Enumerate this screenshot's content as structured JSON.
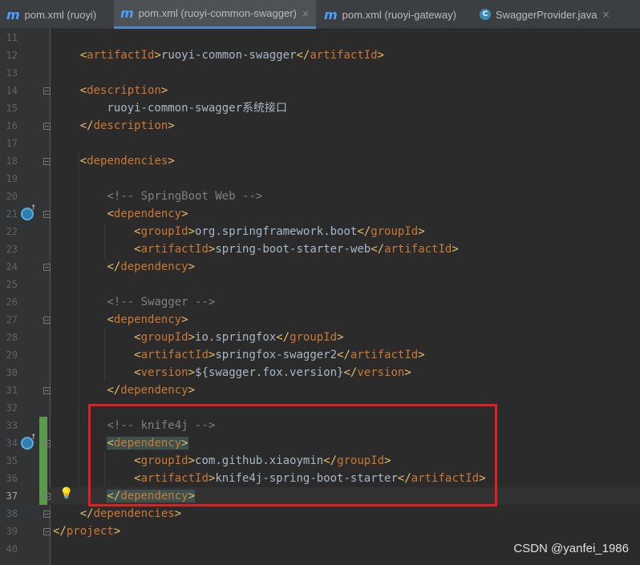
{
  "tabs": [
    {
      "icon": "maven-icon",
      "label": "pom.xml (ruoyi)",
      "active": false
    },
    {
      "icon": "maven-icon",
      "label": "pom.xml (ruoyi-common-swagger)",
      "active": true
    },
    {
      "icon": "maven-icon",
      "label": "pom.xml (ruoyi-gateway)",
      "active": false
    },
    {
      "icon": "class-icon",
      "label": "SwaggerProvider.java",
      "active": false
    }
  ],
  "close_glyph": "×",
  "lines": [
    {
      "n": "11",
      "text": ""
    },
    {
      "n": "12",
      "text": "    <artifactId>ruoyi-common-swagger</artifactId>"
    },
    {
      "n": "13",
      "text": ""
    },
    {
      "n": "14",
      "text": "    <description>"
    },
    {
      "n": "15",
      "text": "        ruoyi-common-swagger系统接口"
    },
    {
      "n": "16",
      "text": "    </description>"
    },
    {
      "n": "17",
      "text": ""
    },
    {
      "n": "18",
      "text": "    <dependencies>"
    },
    {
      "n": "19",
      "text": ""
    },
    {
      "n": "20",
      "text": "        <!-- SpringBoot Web -->"
    },
    {
      "n": "21",
      "text": "        <dependency>"
    },
    {
      "n": "22",
      "text": "            <groupId>org.springframework.boot</groupId>"
    },
    {
      "n": "23",
      "text": "            <artifactId>spring-boot-starter-web</artifactId>"
    },
    {
      "n": "24",
      "text": "        </dependency>"
    },
    {
      "n": "25",
      "text": ""
    },
    {
      "n": "26",
      "text": "        <!-- Swagger -->"
    },
    {
      "n": "27",
      "text": "        <dependency>"
    },
    {
      "n": "28",
      "text": "            <groupId>io.springfox</groupId>"
    },
    {
      "n": "29",
      "text": "            <artifactId>springfox-swagger2</artifactId>"
    },
    {
      "n": "30",
      "text": "            <version>${swagger.fox.version}</version>"
    },
    {
      "n": "31",
      "text": "        </dependency>"
    },
    {
      "n": "32",
      "text": ""
    },
    {
      "n": "33",
      "text": "        <!-- knife4j -->"
    },
    {
      "n": "34",
      "text": "        <dependency>"
    },
    {
      "n": "35",
      "text": "            <groupId>com.github.xiaoymin</groupId>"
    },
    {
      "n": "36",
      "text": "            <artifactId>knife4j-spring-boot-starter</artifactId>"
    },
    {
      "n": "37",
      "text": "        </dependency>"
    },
    {
      "n": "38",
      "text": "    </dependencies>"
    },
    {
      "n": "39",
      "text": "</project>"
    },
    {
      "n": "40",
      "text": ""
    }
  ],
  "current_line": "37",
  "watermark": "CSDN @yanfei_1986",
  "colors": {
    "background": "#2b2b2b",
    "tag": "#e8bf6a",
    "tag_name": "#cc7832",
    "comment": "#808080",
    "highlight_box": "#e02020"
  }
}
